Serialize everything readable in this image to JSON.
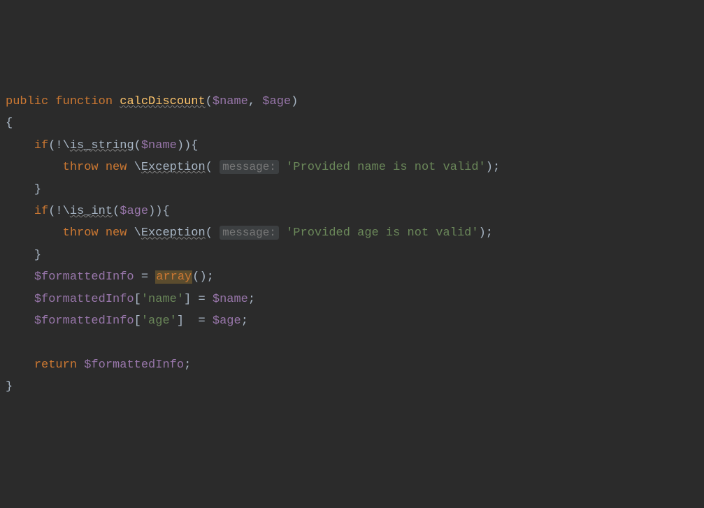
{
  "code": {
    "l1": {
      "kw_public": "public",
      "kw_function": "function",
      "fn_name": "calcDiscount",
      "var_name": "$name",
      "var_age": "$age"
    },
    "l2": {
      "brace": "{"
    },
    "l3": {
      "kw_if": "if",
      "fn_isstring": "is_string",
      "var_name": "$name"
    },
    "l4": {
      "kw_throw": "throw",
      "kw_new": "new",
      "cls_exception": "Exception",
      "hint": "message:",
      "str": "'Provided name is not valid'"
    },
    "l5": {
      "brace": "}"
    },
    "l6": {
      "kw_if": "if",
      "fn_isint": "is_int",
      "var_age": "$age"
    },
    "l7": {
      "kw_throw": "throw",
      "kw_new": "new",
      "cls_exception": "Exception",
      "hint": "message:",
      "str": "'Provided age is not valid'"
    },
    "l8": {
      "brace": "}"
    },
    "l9": {
      "var_fi": "$formattedInfo",
      "kw_array": "array"
    },
    "l10": {
      "var_fi": "$formattedInfo",
      "key": "'name'",
      "var_name": "$name"
    },
    "l11": {
      "var_fi": "$formattedInfo",
      "key": "'age'",
      "var_age": "$age"
    },
    "l12": {
      "kw_return": "return",
      "var_fi": "$formattedInfo"
    },
    "l13": {
      "brace": "}"
    }
  }
}
